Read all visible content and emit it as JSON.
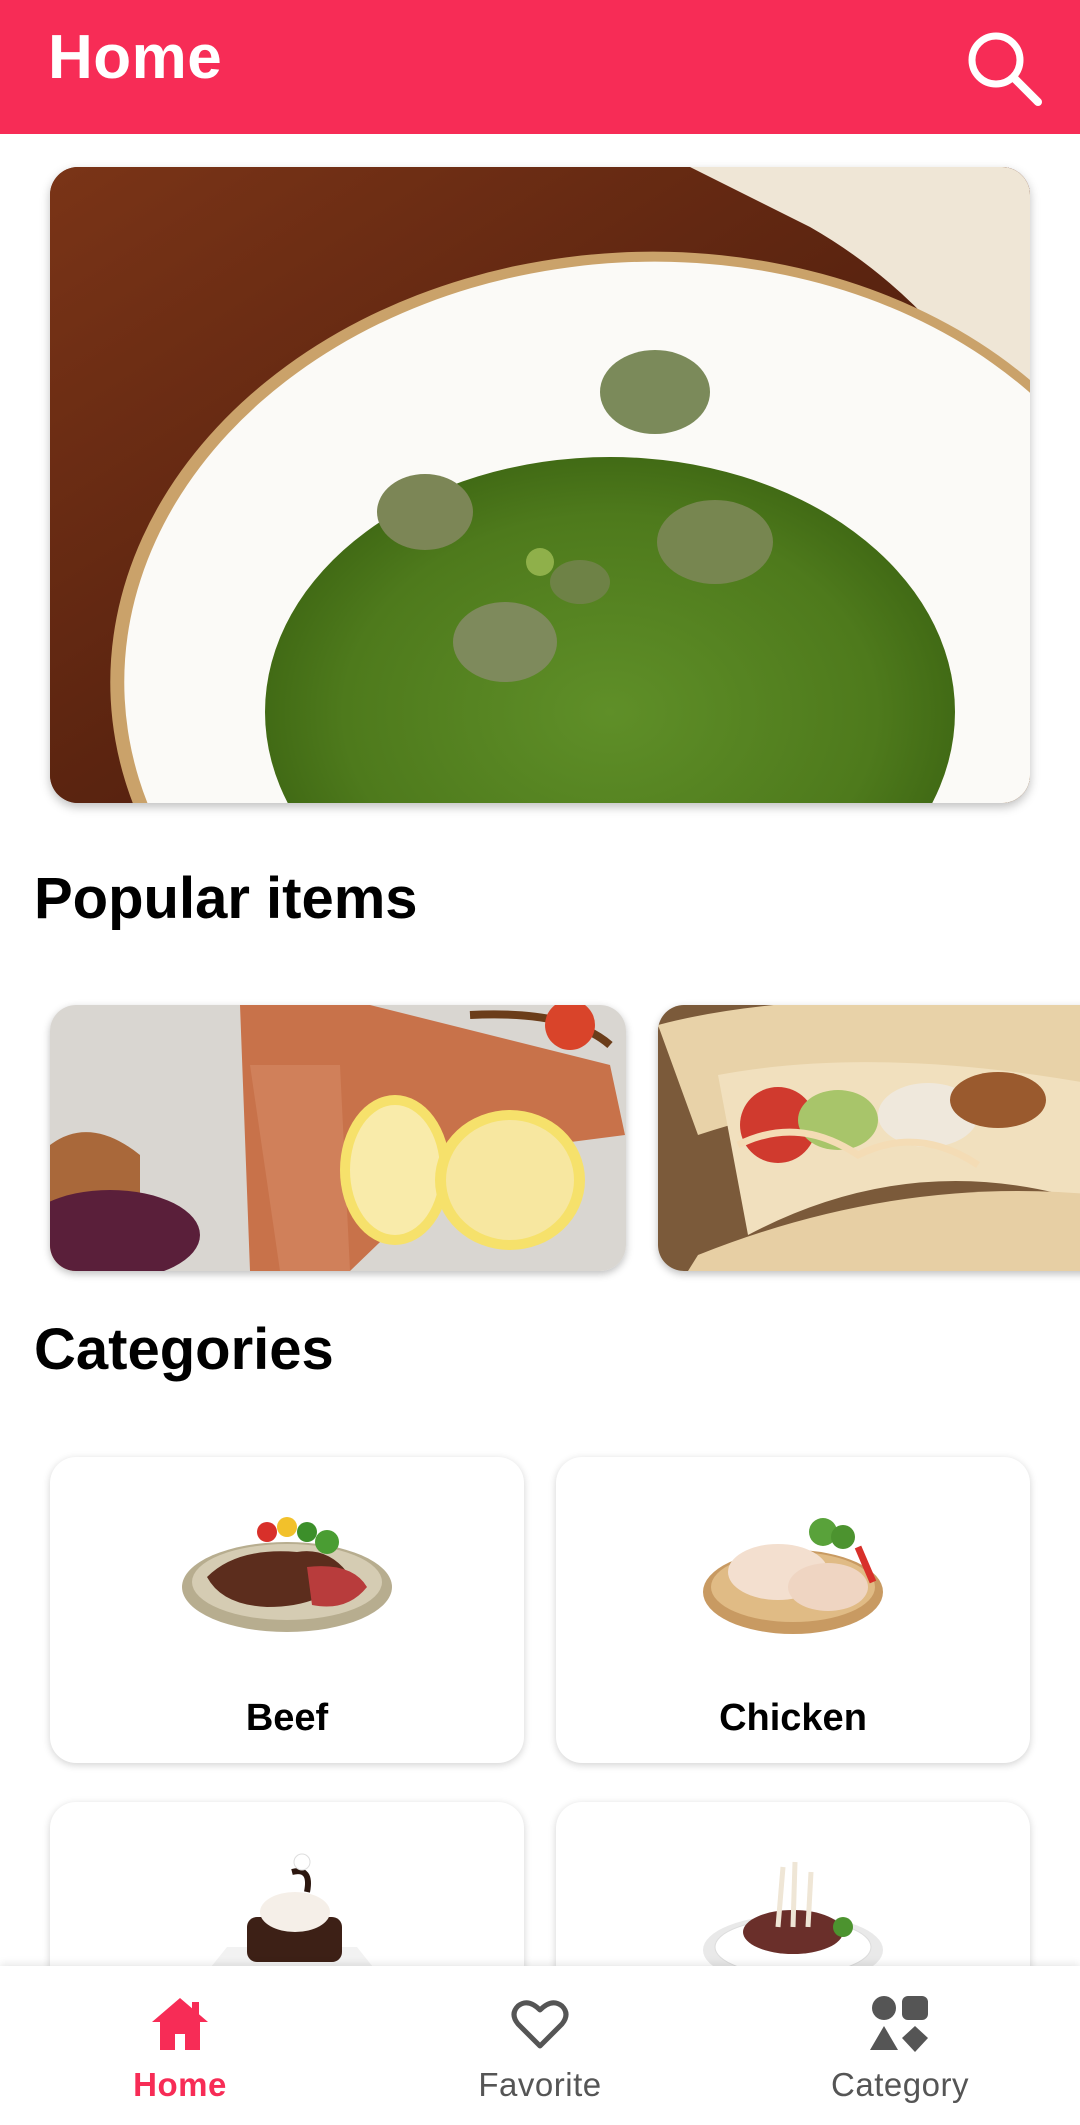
{
  "header": {
    "title": "Home",
    "search_icon": "search-icon",
    "color": "#f72c56"
  },
  "hero": {
    "image": "green-herb-soup-with-meat"
  },
  "popular": {
    "title": "Popular items",
    "items": [
      {
        "image": "grilled-salmon-with-lemon"
      },
      {
        "image": "chicken-tacos"
      }
    ]
  },
  "categories": {
    "title": "Categories",
    "items": [
      {
        "label": "Beef"
      },
      {
        "label": "Chicken"
      },
      {
        "label": ""
      },
      {
        "label": ""
      }
    ]
  },
  "bottom_nav": {
    "active_color": "#f72c56",
    "inactive_color": "#555555",
    "items": [
      {
        "label": "Home",
        "icon": "home-icon",
        "active": true
      },
      {
        "label": "Favorite",
        "icon": "heart-icon",
        "active": false
      },
      {
        "label": "Category",
        "icon": "category-icon",
        "active": false
      }
    ]
  }
}
